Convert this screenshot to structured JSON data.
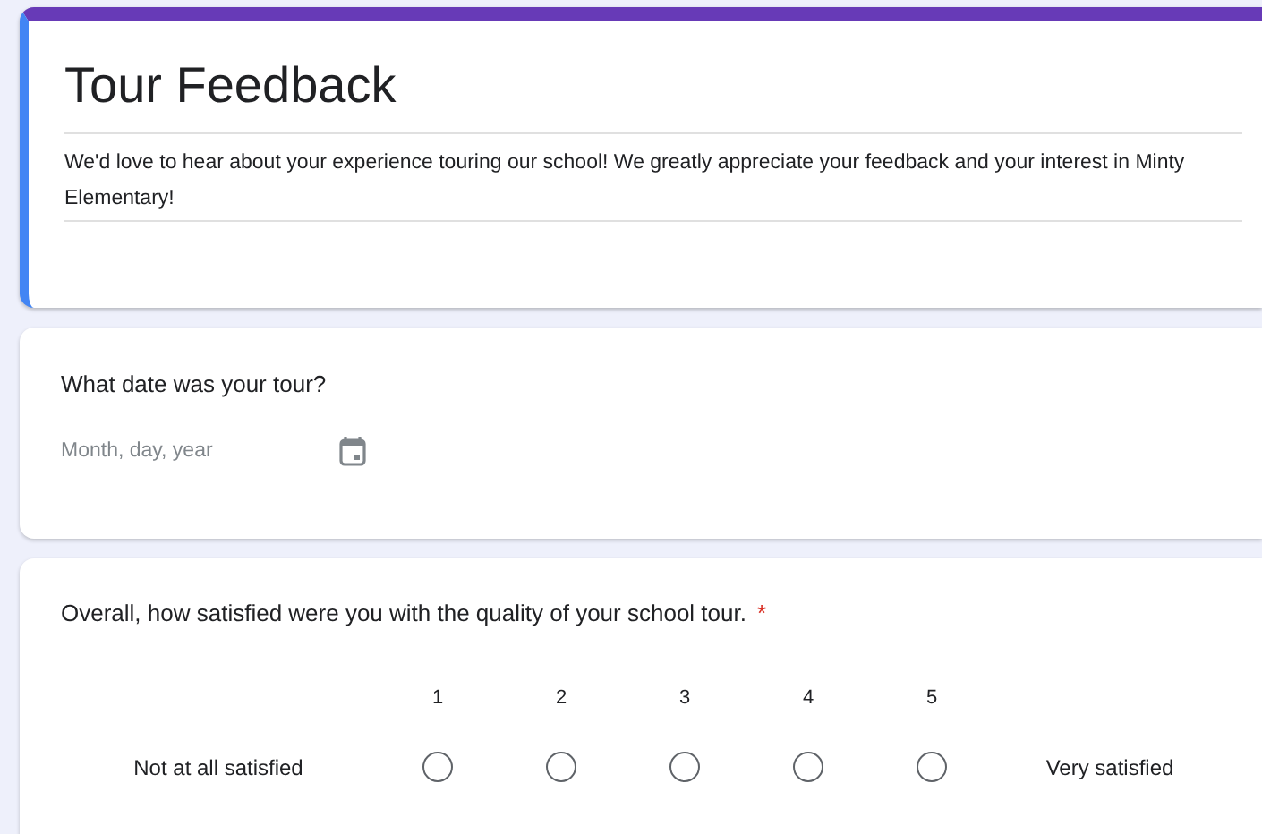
{
  "header": {
    "title": "Tour Feedback",
    "description": "We'd love to hear about your experience touring our school! We greatly appreciate your feedback and your interest in Minty Elementary!"
  },
  "questions": [
    {
      "kind": "date",
      "title": "What date was your tour?",
      "placeholder": "Month, day, year"
    },
    {
      "kind": "scale",
      "title": "Overall, how satisfied were you with the quality of your school tour.",
      "required_mark": "*",
      "low_label": "Not at all satisfied",
      "high_label": "Very satisfied",
      "options": [
        {
          "label": "1",
          "selected": false
        },
        {
          "label": "2",
          "selected": false
        },
        {
          "label": "3",
          "selected": false
        },
        {
          "label": "4",
          "selected": false
        },
        {
          "label": "5",
          "selected": false
        }
      ]
    }
  ]
}
